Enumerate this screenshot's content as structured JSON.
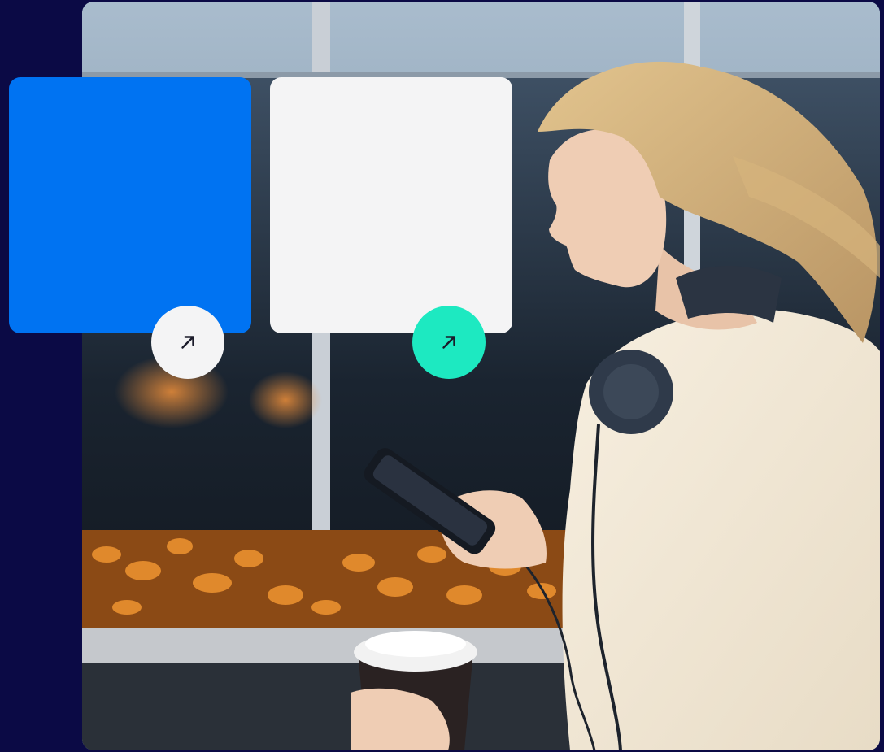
{
  "colors": {
    "background": "#0b0a45",
    "card_primary": "#0073f2",
    "card_secondary": "#f4f4f5",
    "button_light": "#f4f4f5",
    "button_accent": "#1de9c1",
    "arrow": "#1b1b2a"
  },
  "hero": {
    "image": "photo-woman-with-phone-headphones-coffee"
  },
  "cards": [
    {
      "name": "blue-card",
      "icon": "arrow-up-right-icon"
    },
    {
      "name": "white-card",
      "icon": "arrow-up-right-icon"
    }
  ]
}
